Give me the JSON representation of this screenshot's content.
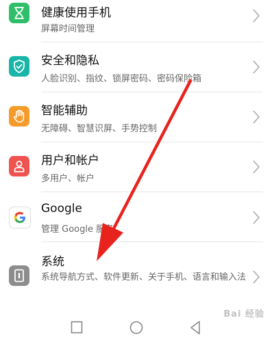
{
  "items": [
    {
      "title": "健康使用手机",
      "subtitle": "屏幕时间管理",
      "icon": "hourglass-icon",
      "color": "#2fbf6a"
    },
    {
      "title": "安全和隐私",
      "subtitle": "人脸识别、指纹、锁屏密码、密码保险箱",
      "icon": "shield-icon",
      "color": "#19b5a8"
    },
    {
      "title": "智能辅助",
      "subtitle": "无障碍、智慧识屏、手势控制",
      "icon": "hand-icon",
      "color": "#f49c2b"
    },
    {
      "title": "用户和帐户",
      "subtitle": "多用户、帐户",
      "icon": "user-icon",
      "color": "#ef5350"
    },
    {
      "title": "Google",
      "subtitle": "管理 Google 服务",
      "icon": "google-icon",
      "color": "#ffffff"
    },
    {
      "title": "系统",
      "subtitle": "系统导航方式、软件更新、关于手机、语言和输入法",
      "icon": "system-icon",
      "color": "#8d8d8d"
    }
  ],
  "navbar": {
    "buttons": [
      "recent-apps",
      "home",
      "back"
    ]
  },
  "annotation": {
    "arrow_color": "#e8231d"
  },
  "watermark": {
    "text": "Bai 经验"
  }
}
